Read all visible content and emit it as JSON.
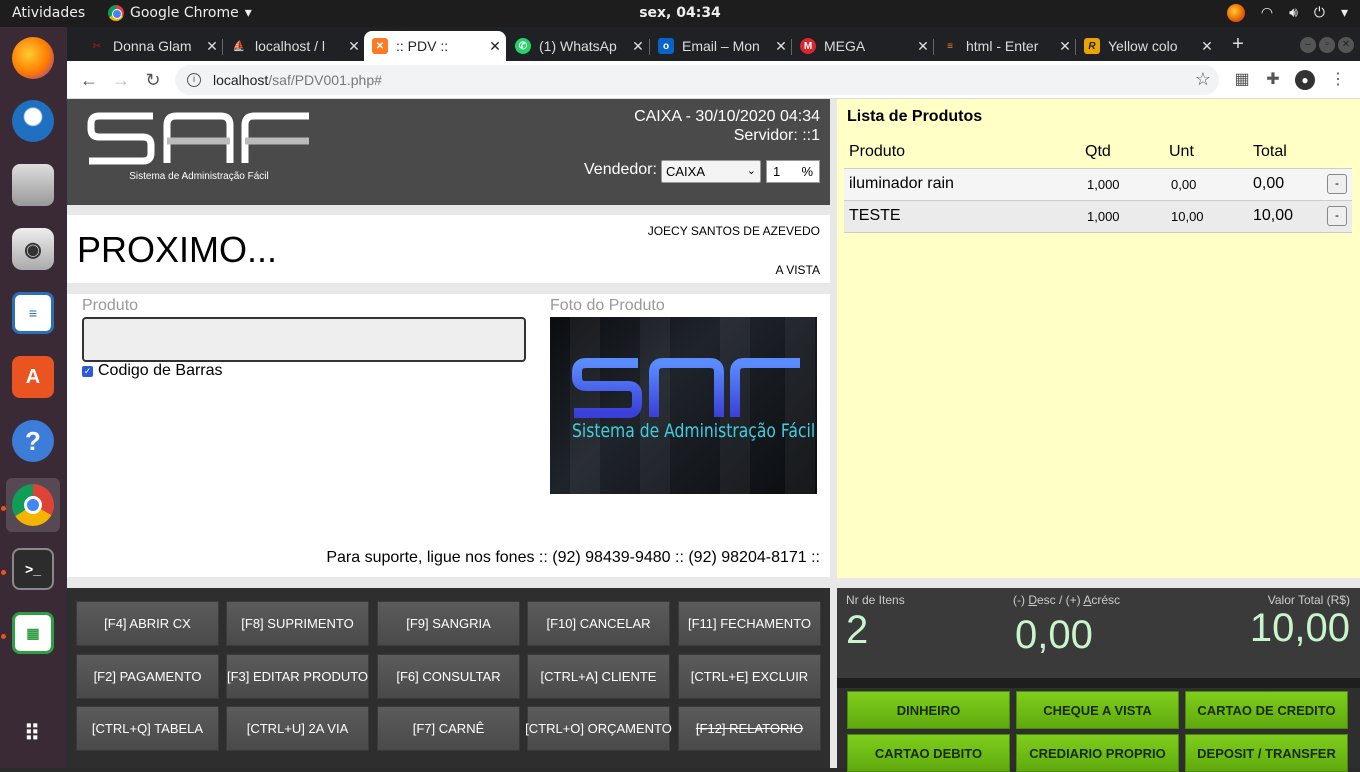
{
  "os": {
    "activities": "Atividades",
    "app_name": "Google Chrome",
    "clock": "sex, 04:34"
  },
  "browser": {
    "tabs": [
      {
        "title": "Donna Glam",
        "favicon": "donna-favicon",
        "color": "#8b1a1a"
      },
      {
        "title": "localhost / l",
        "favicon": "phpmyadmin-favicon",
        "color": "#6c7a89"
      },
      {
        "title": ":: PDV ::",
        "favicon": "xampp-favicon",
        "color": "#fb7a24"
      },
      {
        "title": "(1) WhatsAp",
        "favicon": "whatsapp-favicon",
        "color": "#25d366"
      },
      {
        "title": "Email – Mon",
        "favicon": "outlook-favicon",
        "color": "#0a64c8"
      },
      {
        "title": "MEGA",
        "favicon": "mega-favicon",
        "color": "#d9272e"
      },
      {
        "title": "html - Enter",
        "favicon": "stackoverflow-favicon",
        "color": "#f48024"
      },
      {
        "title": "Yellow colo",
        "favicon": "r-favicon",
        "color": "#e8a400"
      }
    ],
    "url_host": "localhost",
    "url_path": "/saf/PDV001.php#"
  },
  "header": {
    "logo_text": "SAF",
    "logo_sub": "Sistema de Administração Fácil",
    "caixa": "CAIXA - 30/10/2020 04:34",
    "servidor": "Servidor: ::1",
    "vendedor_label": "Vendedor:",
    "vendedor_value": "CAIXA",
    "desconto_value": "1",
    "desconto_unit": "%"
  },
  "message": {
    "main": "PROXIMO...",
    "cliente": "JOECY SANTOS DE AZEVEDO",
    "condicao": "A VISTA"
  },
  "entry": {
    "produto_label": "Produto",
    "produto_value": "",
    "barcode_label": "Codigo de Barras",
    "barcode_checked": true,
    "foto_label": "Foto do Produto",
    "foto_brand": "SAF",
    "foto_caption": "Sistema de Administração Fácil",
    "suporte": "Para suporte, ligue nos fones :: (92) 98439-9480 :: (92) 98204-8171 ::"
  },
  "function_keys": [
    [
      "[F4] ABRIR CX",
      "[F8] SUPRIMENTO",
      "[F9] SANGRIA",
      "[F10] CANCELAR",
      "[F11] FECHAMENTO"
    ],
    [
      "[F2] PAGAMENTO",
      "[F3] EDITAR PRODUTO",
      "[F6] CONSULTAR",
      "[CTRL+A] CLIENTE",
      "[CTRL+E] EXCLUIR"
    ],
    [
      "[CTRL+Q] TABELA",
      "[CTRL+U] 2A VIA",
      "[F7] CARNÊ",
      "[CTRL+O] ORÇAMENTO",
      "[F12] RELATORIO"
    ]
  ],
  "lista": {
    "title": "Lista de Produtos",
    "columns": [
      "Produto",
      "Qtd",
      "Unt",
      "Total"
    ],
    "rows": [
      {
        "produto": "iluminador rain",
        "qtd": "1,000",
        "unt": "0,00",
        "total": "0,00",
        "remove": "-"
      },
      {
        "produto": "TESTE",
        "qtd": "1,000",
        "unt": "10,00",
        "total": "10,00",
        "remove": "-"
      }
    ]
  },
  "totals": {
    "itens_label": "Nr de Itens",
    "itens_value": "2",
    "desc_label_pre": "(-) ",
    "desc_label_d": "D",
    "desc_label_mid": "esc / (+) ",
    "desc_label_a": "A",
    "desc_label_post": "crésc",
    "desc_value": "0,00",
    "total_label": "Valor Total (R$)",
    "total_value": "10,00"
  },
  "payments": [
    [
      "DINHEIRO",
      "CHEQUE A VISTA",
      "CARTAO DE CREDITO"
    ],
    [
      "CARTAO DEBITO",
      "CREDIARIO PROPRIO",
      "DEPOSIT / TRANSFER"
    ]
  ],
  "colors": {
    "header_bg": "#4a4a4a",
    "lista_bg": "#ffffc6",
    "pay_green": "#6fbf15",
    "total_text": "#c9f5cc"
  }
}
